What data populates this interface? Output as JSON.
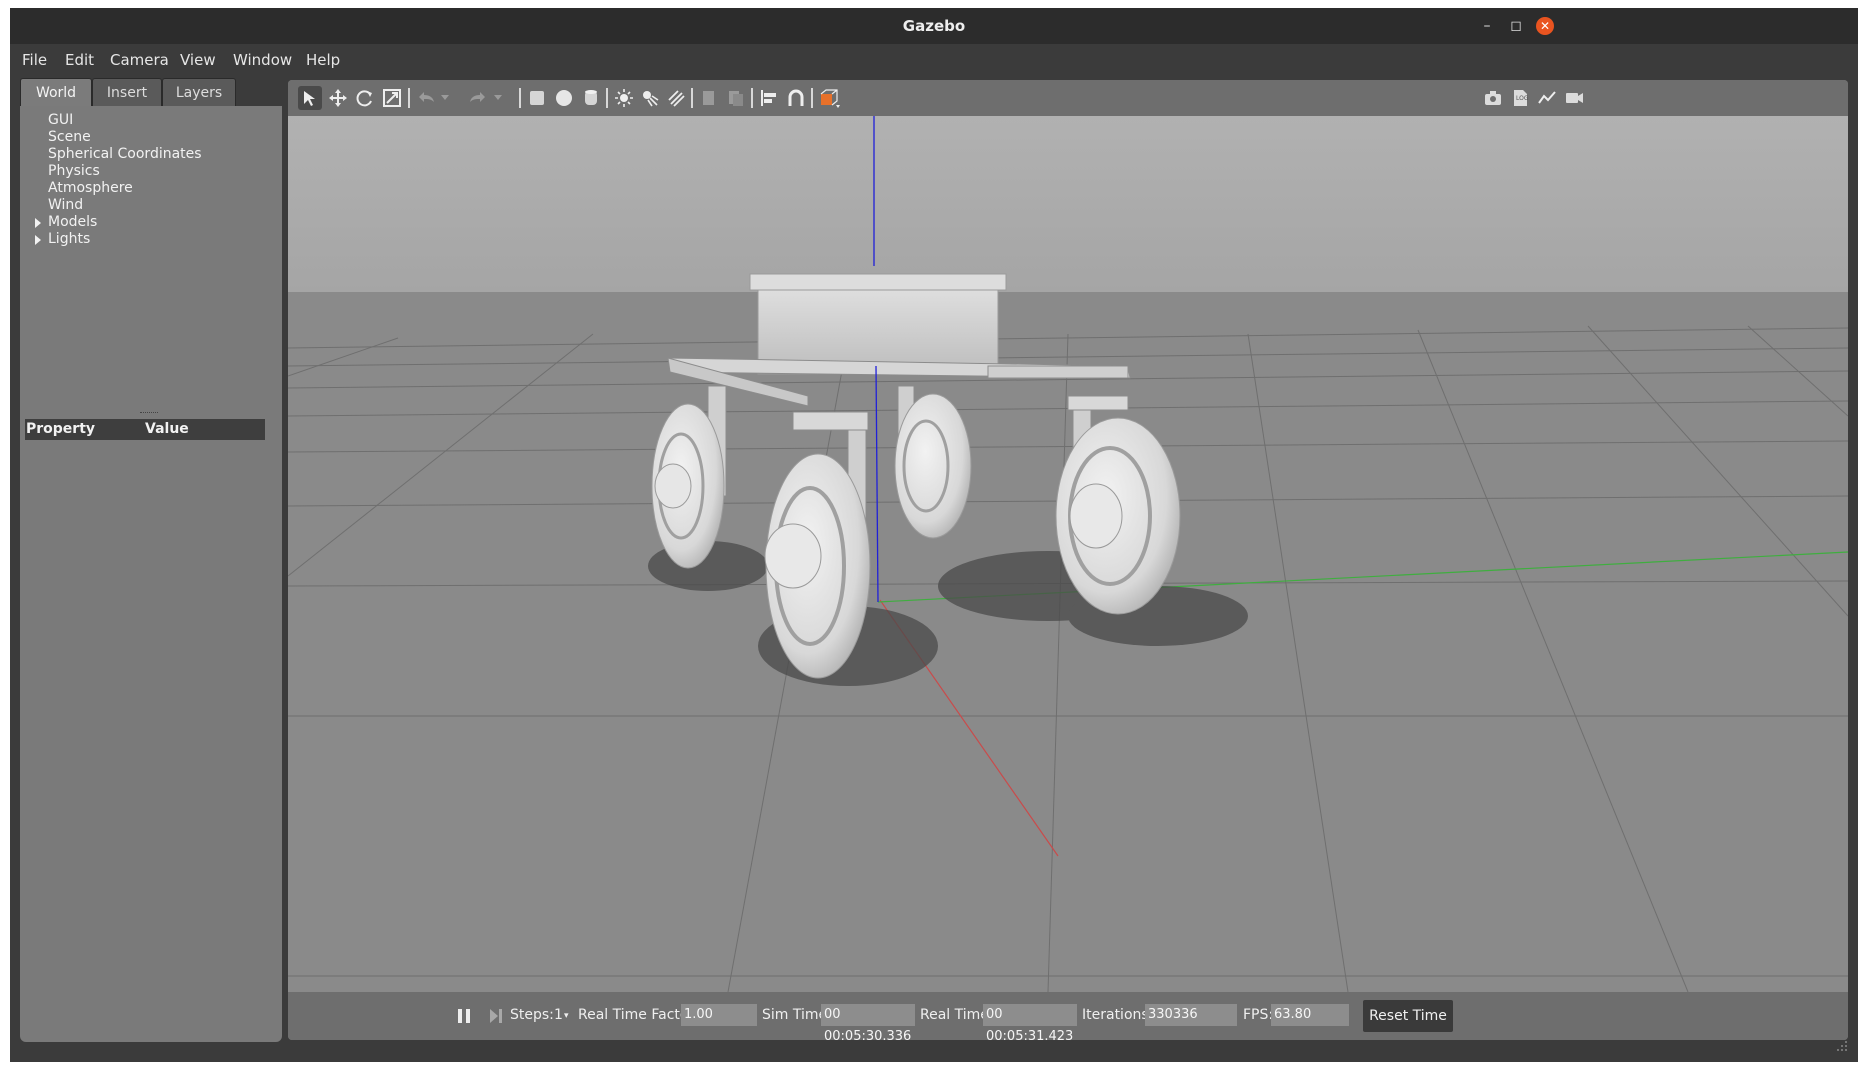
{
  "window": {
    "title": "Gazebo"
  },
  "menubar": {
    "items": [
      "File",
      "Edit",
      "Camera",
      "View",
      "Window",
      "Help"
    ]
  },
  "left_panel": {
    "tabs": [
      "World",
      "Insert",
      "Layers"
    ],
    "active_tab": "World",
    "tree_items": [
      "GUI",
      "Scene",
      "Spherical Coordinates",
      "Physics",
      "Atmosphere",
      "Wind",
      "Models",
      "Lights"
    ],
    "expandable_items": [
      "Models",
      "Lights"
    ],
    "property_headers": {
      "property": "Property",
      "value": "Value"
    }
  },
  "toolbar": {
    "tools": [
      "select-arrow-icon",
      "translate-icon",
      "rotate-icon",
      "scale-icon",
      "undo-icon",
      "redo-icon",
      "box-icon",
      "sphere-icon",
      "cylinder-icon",
      "point-light-icon",
      "spot-light-icon",
      "directional-light-icon",
      "copy-icon",
      "paste-icon",
      "align-icon",
      "snap-icon",
      "view-angle-icon"
    ],
    "right_tools": [
      "screenshot-icon",
      "log-icon",
      "plot-icon",
      "video-record-icon"
    ]
  },
  "status": {
    "steps_label": "Steps:",
    "steps_value": "1",
    "rtf_label": "Real Time Factor:",
    "rtf_value": "1.00",
    "sim_time_label": "Sim Time:",
    "sim_time_value": "00 00:05:30.336",
    "real_time_label": "Real Time:",
    "real_time_value": "00 00:05:31.423",
    "iterations_label": "Iterations:",
    "iterations_value": "330336",
    "fps_label": "FPS:",
    "fps_value": "63.80",
    "reset_label": "Reset Time"
  },
  "colors": {
    "close_button": "#e95420",
    "accent_orange": "#e8712a"
  }
}
